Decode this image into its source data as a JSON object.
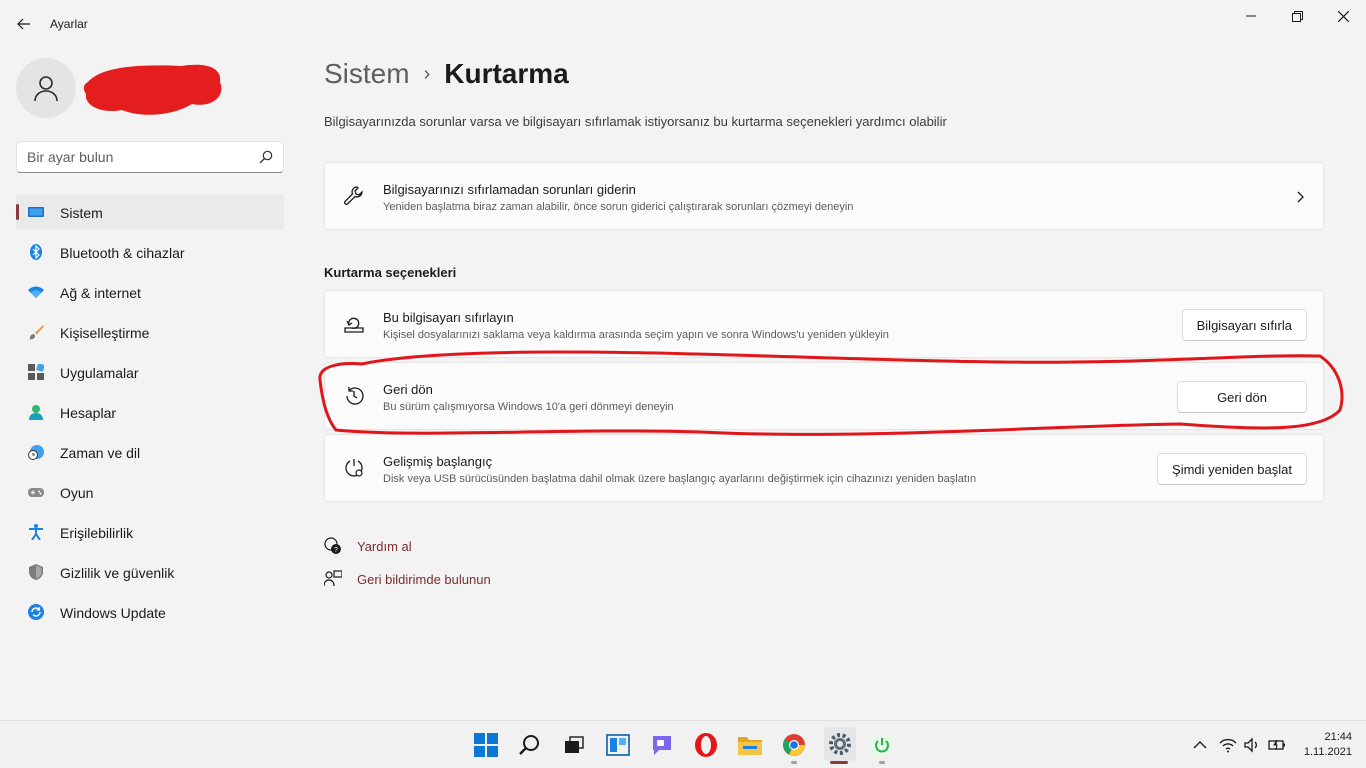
{
  "app": {
    "title": "Ayarlar"
  },
  "search": {
    "placeholder": "Bir ayar bulun"
  },
  "nav": {
    "items": [
      {
        "label": "Sistem",
        "active": true
      },
      {
        "label": "Bluetooth & cihazlar"
      },
      {
        "label": "Ağ & internet"
      },
      {
        "label": "Kişiselleştirme"
      },
      {
        "label": "Uygulamalar"
      },
      {
        "label": "Hesaplar"
      },
      {
        "label": "Zaman ve dil"
      },
      {
        "label": "Oyun"
      },
      {
        "label": "Erişilebilirlik"
      },
      {
        "label": "Gizlilik ve güvenlik"
      },
      {
        "label": "Windows Update"
      }
    ]
  },
  "breadcrumb": {
    "parent": "Sistem",
    "separator": "›",
    "current": "Kurtarma"
  },
  "page": {
    "description": "Bilgisayarınızda sorunlar varsa ve bilgisayarı sıfırlamak istiyorsanız bu kurtarma seçenekleri yardımcı olabilir"
  },
  "troubleshoot": {
    "title": "Bilgisayarınızı sıfırlamadan sorunları giderin",
    "subtitle": "Yeniden başlatma biraz zaman alabilir, önce sorun giderici çalıştırarak sorunları çözmeyi deneyin"
  },
  "recovery": {
    "section_title": "Kurtarma seçenekleri",
    "reset": {
      "title": "Bu bilgisayarı sıfırlayın",
      "subtitle": "Kişisel dosyalarınızı saklama veya kaldırma arasında seçim yapın ve sonra Windows'u yeniden yükleyin",
      "button": "Bilgisayarı sıfırla"
    },
    "goback": {
      "title": "Geri dön",
      "subtitle": "Bu sürüm çalışmıyorsa Windows 10'a geri dönmeyi deneyin",
      "button": "Geri dön"
    },
    "advanced": {
      "title": "Gelişmiş başlangıç",
      "subtitle": "Disk veya USB sürücüsünden başlatma dahil olmak üzere başlangıç ayarlarını değiştirmek için cihazınızı yeniden başlatın",
      "button": "Şimdi yeniden başlat"
    }
  },
  "links": {
    "help": "Yardım al",
    "feedback": "Geri bildirimde bulunun"
  },
  "taskbar": {
    "time": "21:44",
    "date": "1.11.2021"
  },
  "colors": {
    "accent": "#8b3a3a",
    "annotation": "#e0161b",
    "link": "#7a2e2e"
  }
}
